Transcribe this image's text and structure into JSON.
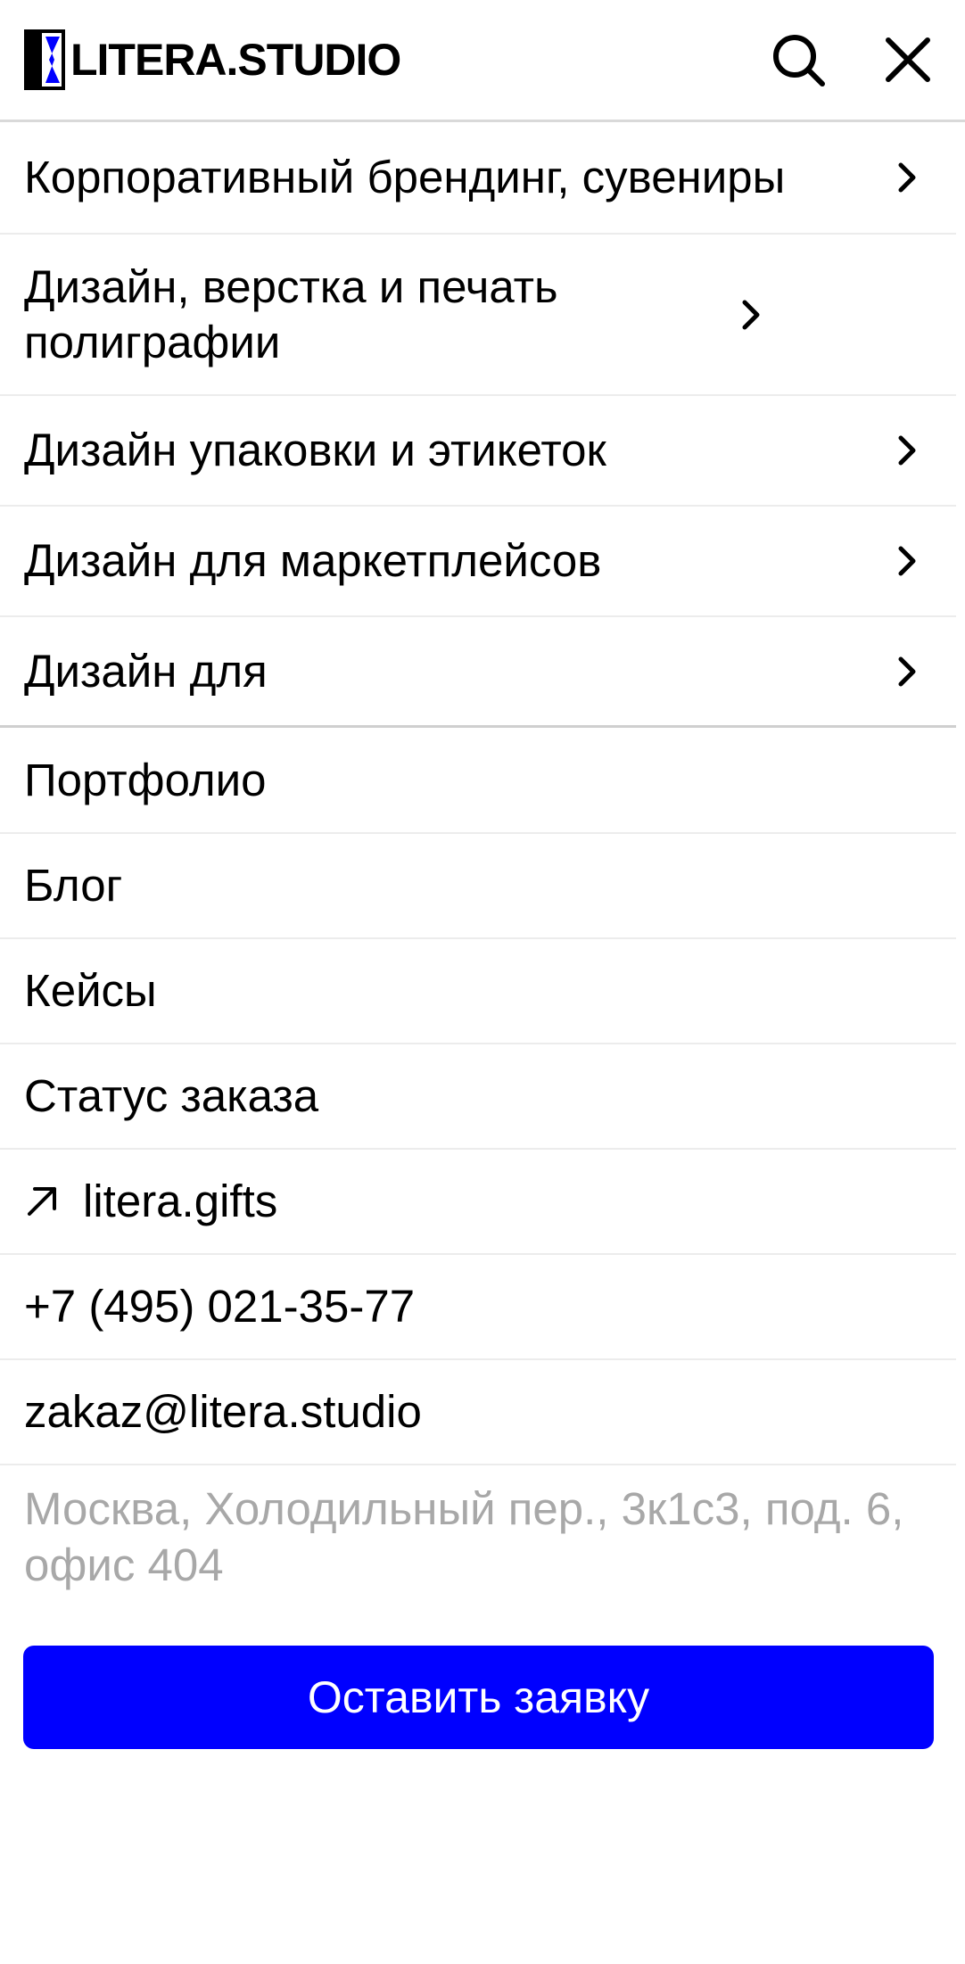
{
  "header": {
    "logo_text": "LITERA.STUDIO",
    "search_icon": "search-icon",
    "close_icon": "close-icon"
  },
  "services": [
    {
      "label": "Корпоративный брендинг, сувениры"
    },
    {
      "label": "Дизайн, верстка и печать полиграфии"
    },
    {
      "label": "Дизайн упаковки и этикеток"
    },
    {
      "label": "Дизайн для маркетплейсов"
    },
    {
      "label": "Дизайн для"
    }
  ],
  "nav": [
    {
      "label": "Портфолио"
    },
    {
      "label": "Блог"
    },
    {
      "label": "Кейсы"
    },
    {
      "label": "Статус заказа"
    }
  ],
  "external_link": {
    "label": "litera.gifts",
    "icon": "arrow-up-right-icon"
  },
  "contacts": {
    "phone": "+7 (495) 021-35-77",
    "email": "zakaz@litera.studio",
    "address": "Москва, Холодильный пер., 3к1с3, под. 6, офис 404"
  },
  "cta": {
    "label": "Оставить заявку"
  },
  "colors": {
    "accent": "#0000ff",
    "text": "#000000",
    "muted": "#a8a8a8",
    "divider": "#ececec"
  }
}
